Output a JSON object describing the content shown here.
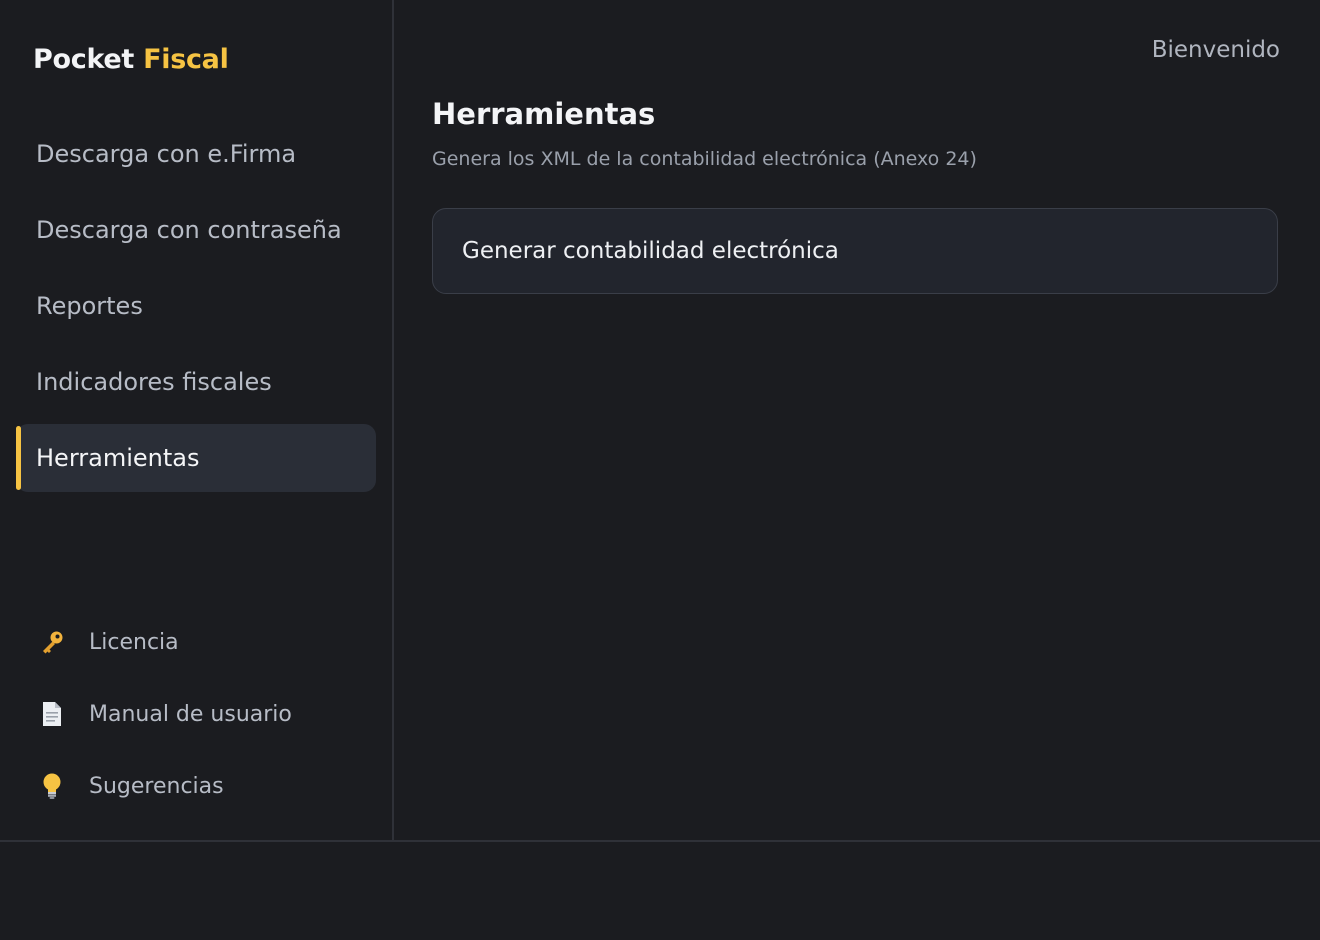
{
  "brand": {
    "part1": "Pocket",
    "part2": "Fiscal"
  },
  "sidebar": {
    "items": [
      {
        "label": "Descarga con e.Firma"
      },
      {
        "label": "Descarga con contraseña"
      },
      {
        "label": "Reportes"
      },
      {
        "label": "Indicadores fiscales"
      },
      {
        "label": "Herramientas",
        "active": true
      }
    ],
    "bottom_links": [
      {
        "label": "Licencia",
        "icon": "key-icon"
      },
      {
        "label": "Manual de usuario",
        "icon": "document-icon"
      },
      {
        "label": "Sugerencias",
        "icon": "lightbulb-icon"
      }
    ]
  },
  "header": {
    "welcome": "Bienvenido"
  },
  "main": {
    "title": "Herramientas",
    "subtitle": "Genera los XML de la contabilidad electrónica (Anexo 24)",
    "card_label": "Generar contabilidad electrónica"
  },
  "colors": {
    "accent": "#f6c343",
    "background": "#1b1c20",
    "active_item": "#2a2e37"
  }
}
